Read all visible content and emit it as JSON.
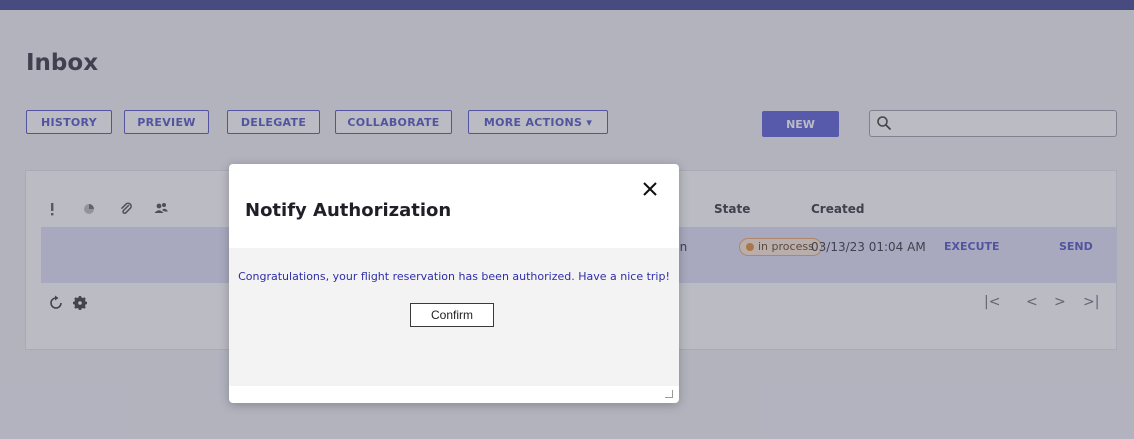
{
  "page": {
    "title": "Inbox"
  },
  "toolbar": {
    "history": "HISTORY",
    "preview": "PREVIEW",
    "delegate": "DELEGATE",
    "collaborate": "COLLABORATE",
    "more_actions": "MORE ACTIONS ▾",
    "new": "NEW"
  },
  "search": {
    "value": "",
    "placeholder": ""
  },
  "table": {
    "columns": {
      "state": "State",
      "created": "Created"
    },
    "rows": [
      {
        "task_fragment": "ion",
        "state": "in process",
        "created": "03/13/23 01:04 AM",
        "execute": "EXECUTE",
        "send": "SEND"
      }
    ]
  },
  "pagination": {
    "first": "|<",
    "prev": "<",
    "next": ">",
    "last": ">|"
  },
  "modal": {
    "title": "Notify Authorization",
    "message": "Congratulations, your flight reservation has been authorized. Have a nice trip!",
    "confirm_label": "Confirm"
  },
  "colors": {
    "accent": "#4b4fc1",
    "primary_button": "#5457d6",
    "selected_row": "#dfe0f7",
    "badge_border": "#e6a56a",
    "badge_dot": "#e48a2e",
    "message_text": "#2e2ea8"
  },
  "icons": {
    "header": [
      "priority-icon",
      "status-icon",
      "attachment-icon",
      "collaborators-icon"
    ],
    "footer": [
      "refresh-icon",
      "gear-icon"
    ],
    "search": "search-icon",
    "close": "close-icon"
  }
}
